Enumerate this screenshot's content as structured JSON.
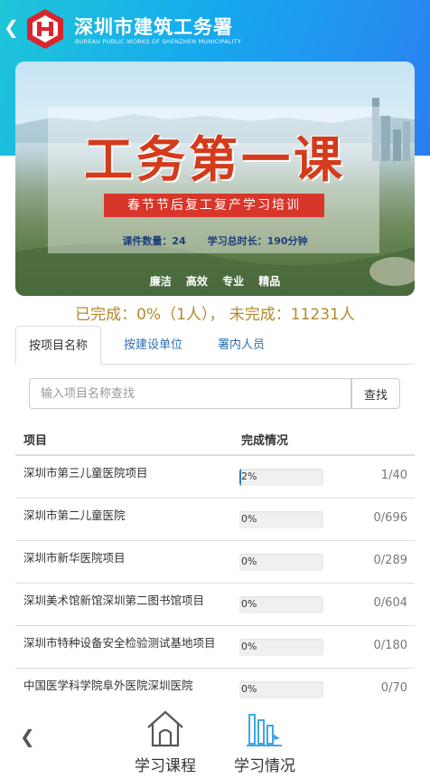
{
  "header": {
    "title": "深圳市建筑工务署",
    "subtitle": "BUREAU PUBLIC WORKS OF SHENZHEN MUNICIPALITY"
  },
  "banner": {
    "title": "工务第一课",
    "ribbon": "春节节后复工复产学习培训",
    "course_count": "课件数量：24",
    "total_duration": "学习总时长：190分钟",
    "slogans": [
      "廉洁",
      "高效",
      "专业",
      "精品"
    ]
  },
  "summary": "已完成：0%（1人）， 未完成：11231人",
  "tabs": [
    {
      "label": "按项目名称"
    },
    {
      "label": "按建设单位"
    },
    {
      "label": "署内人员"
    }
  ],
  "search": {
    "placeholder": "输入项目名称查找",
    "button_label": "查找"
  },
  "table": {
    "headers": {
      "project": "项目",
      "status": "完成情况"
    },
    "rows": [
      {
        "name": "深圳市第三儿童医院项目",
        "progress_label": "2%",
        "progress": 0.02,
        "count": "1/40"
      },
      {
        "name": "深圳市第二儿童医院",
        "progress_label": "0%",
        "progress": 0,
        "count": "0/696"
      },
      {
        "name": "深圳市新华医院项目",
        "progress_label": "0%",
        "progress": 0,
        "count": "0/289"
      },
      {
        "name": "深圳美术馆新馆深圳第二图书馆项目",
        "progress_label": "0%",
        "progress": 0,
        "count": "0/604"
      },
      {
        "name": "深圳市特种设备安全检验测试基地项目",
        "progress_label": "0%",
        "progress": 0,
        "count": "0/180"
      },
      {
        "name": "中国医学科学院阜外医院深圳医院",
        "progress_label": "0%",
        "progress": 0,
        "count": "0/70"
      }
    ]
  },
  "bottom_nav": {
    "items": [
      {
        "label": "学习课程",
        "icon": "home-icon"
      },
      {
        "label": "学习情况",
        "icon": "chart-icon"
      }
    ]
  },
  "colors": {
    "header_gradient_start": "#1ec6d8",
    "header_gradient_end": "#2b7ff0",
    "logo_red": "#d9262c",
    "summary_gold": "#b08a2e",
    "link_blue": "#2f6fb2",
    "progress_blue": "#337ab7",
    "chart_icon_blue": "#3fa7e8"
  }
}
